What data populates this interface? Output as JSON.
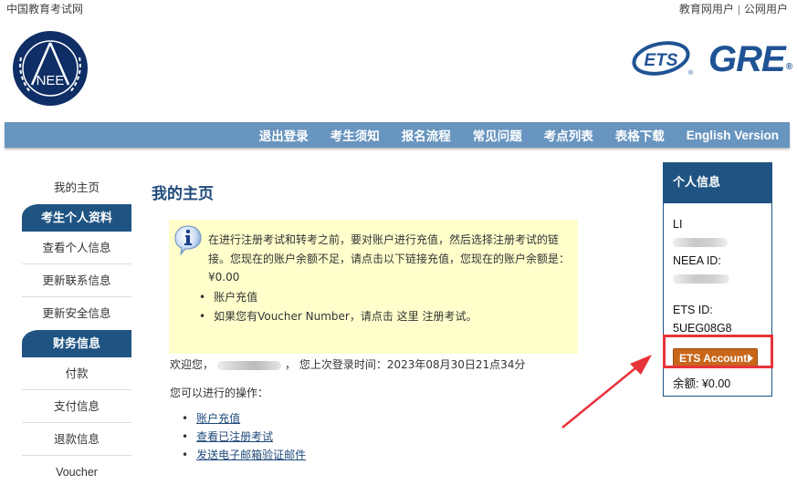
{
  "header": {
    "site_link": "中国教育考试网",
    "user_links": [
      "教育网用户",
      "公网用户"
    ],
    "separator": "|",
    "neea_logo_text": "NEE",
    "ets_logo_text": "ETS",
    "gre_logo_text": "GRE",
    "registered_mark": "®"
  },
  "nav": {
    "items": [
      "退出登录",
      "考生须知",
      "报名流程",
      "常见问题",
      "考点列表",
      "表格下载",
      "English Version"
    ]
  },
  "sidebar": {
    "home": "我的主页",
    "sections": [
      {
        "title": "考生个人资料",
        "items": [
          "查看个人信息",
          "更新联系信息",
          "更新安全信息"
        ]
      },
      {
        "title": "财务信息",
        "items": [
          "付款",
          "支付信息",
          "退款信息",
          "Voucher"
        ]
      }
    ]
  },
  "main": {
    "title": "我的主页",
    "notice": {
      "text": "在进行注册考试和转考之前，要对账户进行充值，然后选择注册考试的链接。您现在的账户余额不足，请点击以下链接充值，您现在的账户余额是：¥0.00",
      "items": [
        "账户充值",
        "如果您有Voucher Number，请点击 这里 注册考试。"
      ]
    },
    "welcome_prefix": "欢迎您，",
    "welcome_suffix": "，  您上次登录时间：2023年08月30日21点34分",
    "ops_title": "您可以进行的操作：",
    "ops": [
      "账户充值",
      "查看已注册考试",
      "发送电子邮箱验证邮件"
    ]
  },
  "profile": {
    "title": "个人信息",
    "name": "LI",
    "neea_label": "NEEA ID:",
    "ets_label": "ETS ID:",
    "ets_id": "5UEG08G8",
    "ets_button": "ETS Account",
    "balance": "余额: ¥0.00"
  },
  "annotation": {
    "color": "#e8333a"
  }
}
